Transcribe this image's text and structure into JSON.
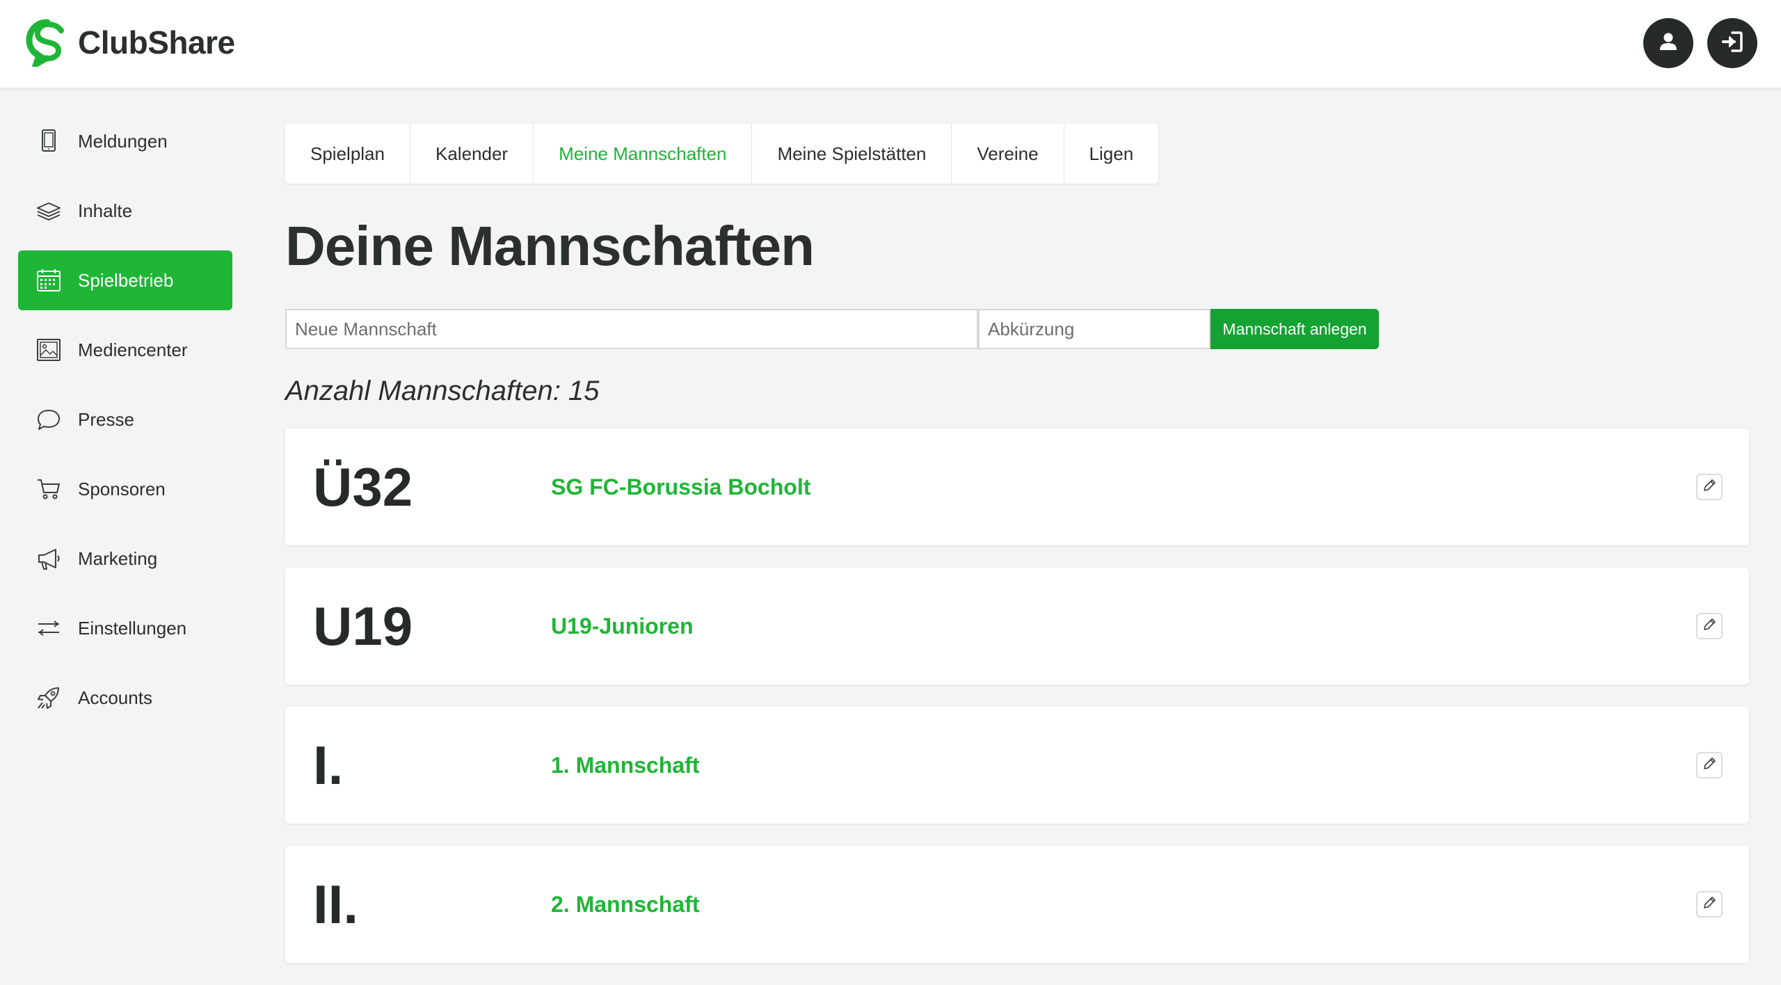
{
  "app": {
    "name": "ClubShare",
    "brand_color": "#1fb537",
    "dark_color": "#262a29"
  },
  "header": {
    "logo_icon": "clubshare-logo-icon",
    "user_icon": "user-icon",
    "logout_icon": "logout-icon"
  },
  "sidebar": {
    "items": [
      {
        "label": "Meldungen",
        "icon": "tablet-icon",
        "active": false
      },
      {
        "label": "Inhalte",
        "icon": "layers-icon",
        "active": false
      },
      {
        "label": "Spielbetrieb",
        "icon": "calendar-icon",
        "active": true
      },
      {
        "label": "Mediencenter",
        "icon": "image-icon",
        "active": false
      },
      {
        "label": "Presse",
        "icon": "chat-bubble-icon",
        "active": false
      },
      {
        "label": "Sponsoren",
        "icon": "cart-icon",
        "active": false
      },
      {
        "label": "Marketing",
        "icon": "megaphone-icon",
        "active": false
      },
      {
        "label": "Einstellungen",
        "icon": "sliders-icon",
        "active": false
      },
      {
        "label": "Accounts",
        "icon": "rocket-icon",
        "active": false
      }
    ]
  },
  "tabs": [
    {
      "label": "Spielplan",
      "active": false
    },
    {
      "label": "Kalender",
      "active": false
    },
    {
      "label": "Meine Mannschaften",
      "active": true
    },
    {
      "label": "Meine Spielstätten",
      "active": false
    },
    {
      "label": "Vereine",
      "active": false
    },
    {
      "label": "Ligen",
      "active": false
    }
  ],
  "main": {
    "title": "Deine Mannschaften",
    "form": {
      "name_placeholder": "Neue Mannschaft",
      "name_value": "",
      "abbr_placeholder": "Abkürzung",
      "abbr_value": "",
      "submit_label": "Mannschaft anlegen"
    },
    "count_label": "Anzahl Mannschaften: 15",
    "teams": [
      {
        "abbr": "Ü32",
        "name": "SG FC-Borussia Bocholt",
        "edit_icon": "pencil-icon"
      },
      {
        "abbr": "U19",
        "name": "U19-Junioren",
        "edit_icon": "pencil-icon"
      },
      {
        "abbr": "I.",
        "name": "1. Mannschaft",
        "edit_icon": "pencil-icon"
      },
      {
        "abbr": "II.",
        "name": "2. Mannschaft",
        "edit_icon": "pencil-icon"
      }
    ]
  }
}
